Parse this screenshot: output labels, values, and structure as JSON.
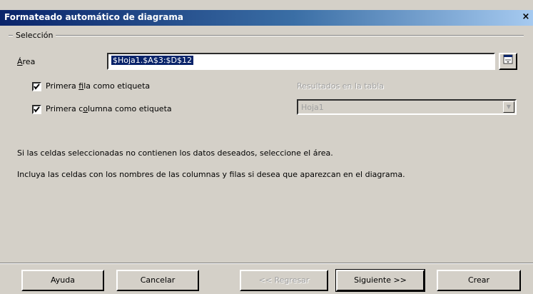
{
  "dialog": {
    "title": "Formateado automático de diagrama",
    "close_glyph": "×"
  },
  "selection": {
    "group_label": "Selección",
    "area_label_prefix": "",
    "area_label_accel": "Á",
    "area_label_rest": "rea",
    "area_value": "$Hoja1.$A$3:$D$12",
    "first_row": {
      "checked": true,
      "label_pre": "Primera ",
      "label_accel": "f",
      "label_post": "ila como etiqueta"
    },
    "first_col": {
      "checked": true,
      "label_pre": "Primera c",
      "label_accel": "o",
      "label_post": "lumna como etiqueta"
    },
    "results_label": "Resultados en la tabla",
    "results_value": "Hoja1"
  },
  "hints": {
    "line1": "Si las celdas seleccionadas no contienen los datos deseados, seleccione el área.",
    "line2": "Incluya las celdas con los nombres de las columnas y filas si desea que aparezcan en el diagrama."
  },
  "buttons": {
    "help": "Ayuda",
    "cancel": "Cancelar",
    "back": "<< Regresar",
    "next": "Siguiente >>",
    "create": "Crear"
  },
  "icons": {
    "shrink": "shrink-icon",
    "dropdown": "chevron-down-icon",
    "check": "check-icon",
    "close": "close-icon"
  }
}
